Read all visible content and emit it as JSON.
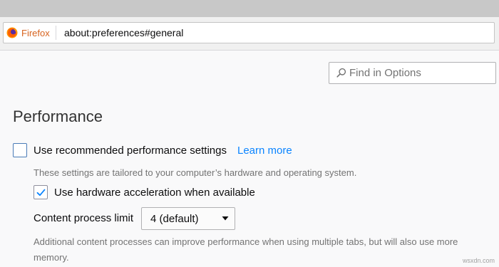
{
  "browser": {
    "identity_label": "Firefox",
    "url": "about:preferences#general"
  },
  "search": {
    "placeholder": "Find in Options",
    "icon": "magnifier-icon"
  },
  "performance": {
    "title": "Performance",
    "recommended": {
      "label": "Use recommended performance settings",
      "checked": false,
      "learn_more": "Learn more",
      "description": "These settings are tailored to your computer’s hardware and operating system."
    },
    "hardware_acceleration": {
      "label": "Use hardware acceleration when available",
      "checked": true
    },
    "content_process_limit": {
      "label": "Content process limit",
      "selected": "4 (default)",
      "description": "Additional content processes can improve performance when using multiple tabs, but will also use more memory."
    }
  },
  "colors": {
    "accent": "#0a84ff",
    "checkbox_check": "#0a84ff",
    "firefox_label": "#d7631e"
  },
  "watermark": "wsxdn.com"
}
